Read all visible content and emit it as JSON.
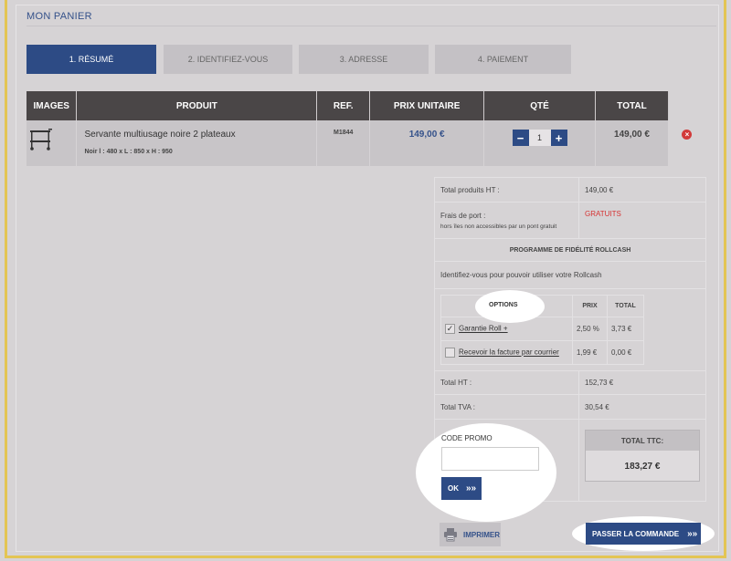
{
  "page": {
    "title": "MON PANIER"
  },
  "steps": [
    {
      "label": "1. RÉSUMÉ"
    },
    {
      "label": "2. IDENTIFIEZ-VOUS"
    },
    {
      "label": "3. ADRESSE"
    },
    {
      "label": "4. PAIEMENT"
    }
  ],
  "cart": {
    "headers": {
      "images": "IMAGES",
      "product": "PRODUIT",
      "ref": "REF.",
      "unit_price": "PRIX UNITAIRE",
      "qty": "QTÉ",
      "total": "TOTAL"
    },
    "items": [
      {
        "name": "Servante multiusage noire 2 plateaux",
        "dims": "Noir l : 480 x L : 850 x H : 950",
        "ref": "M1844",
        "unit_price": "149,00 €",
        "qty": "1",
        "total": "149,00 €",
        "minus": "−",
        "plus": "+",
        "remove": "×"
      }
    ]
  },
  "summary": {
    "products_ht_label": "Total produits HT :",
    "products_ht_value": "149,00 €",
    "shipping_label": "Frais de port :",
    "shipping_note": "hors îles non accessibles par un pont gratuit",
    "shipping_value": "GRATUITS",
    "loyalty_title": "PROGRAMME DE FIDÉLITÉ ROLLCASH",
    "loyalty_text": "Identifiez-vous pour pouvoir utiliser votre Rollcash",
    "options": {
      "headers": {
        "options": "OPTIONS",
        "price": "PRIX",
        "total": "TOTAL"
      },
      "rows": [
        {
          "label": "Garantie Roll +",
          "price": "2,50 %",
          "total": "3,73 €",
          "checked": "✓"
        },
        {
          "label": "Recevoir la facture par courrier",
          "price": "1,99 €",
          "total": "0,00 €",
          "checked": ""
        }
      ]
    },
    "total_ht_label": "Total HT :",
    "total_ht_value": "152,73 €",
    "total_tva_label": "Total TVA :",
    "total_tva_value": "30,54 €"
  },
  "promo": {
    "label": "CODE PROMO",
    "placeholder": "",
    "ok_label": "OK"
  },
  "ttc": {
    "label": "TOTAL TTC:",
    "value": "183,27 €"
  },
  "actions": {
    "print_label": "IMPRIMER",
    "checkout_label": "PASSER LA COMMANDE",
    "arrows": "»»"
  },
  "colors": {
    "accent": "#2d4b85",
    "frame": "#e3c554",
    "danger": "#d23a3a"
  }
}
